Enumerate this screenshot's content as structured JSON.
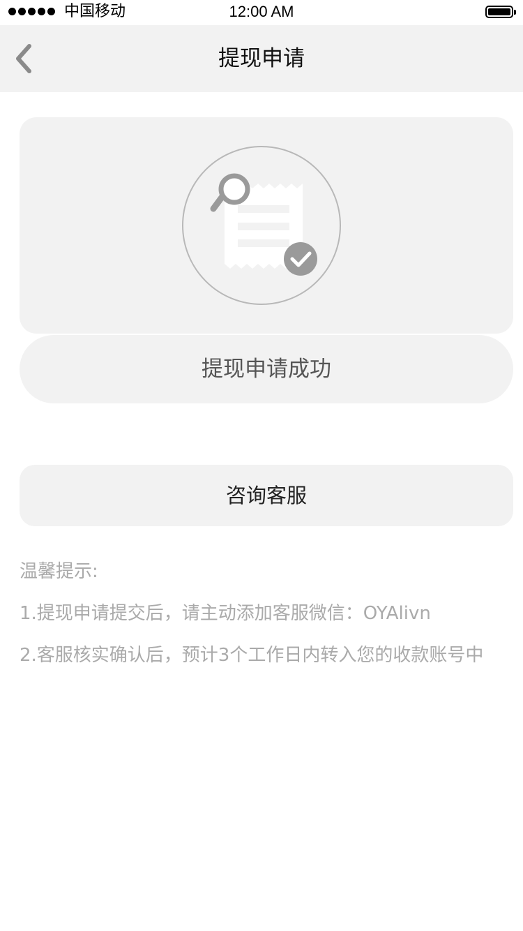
{
  "status_bar": {
    "carrier": "中国移动",
    "time": "12:00 AM",
    "signal_icon": "signal-dots-icon",
    "battery_icon": "battery-full-icon"
  },
  "nav": {
    "back_icon": "chevron-left-icon",
    "title": "提现申请"
  },
  "result": {
    "icon": "receipt-search-check-icon",
    "message": "提现申请成功"
  },
  "contact_button": {
    "label": "咨询客服"
  },
  "tips": {
    "title": "温馨提示:",
    "lines": [
      "1.提现申请提交后，请主动添加客服微信：OYAlivn",
      "2.客服核实确认后，预计3个工作日内转入您的收款账号中"
    ]
  },
  "colors": {
    "panel_background": "#f2f2f2",
    "icon_gray": "#9a9a9a",
    "tips_text": "#aaaaaa"
  }
}
